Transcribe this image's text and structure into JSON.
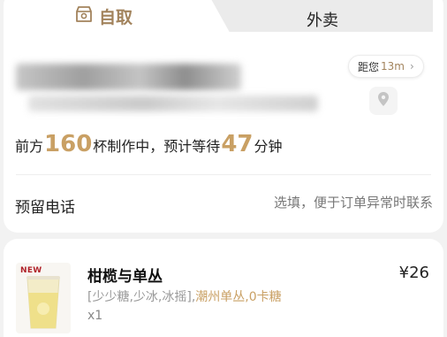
{
  "tabs": {
    "pickup_label": "自取",
    "delivery_label": "外卖",
    "active": "pickup"
  },
  "store": {
    "distance_prefix": "距您",
    "distance_value": "13m",
    "map_pin_icon": "location-pin-icon"
  },
  "queue": {
    "prefix": "前方",
    "cups": "160",
    "middle": "杯制作中，预计等待",
    "minutes": "47",
    "suffix": "分钟"
  },
  "phone": {
    "label": "预留电话",
    "placeholder": "选填，便于订单异常时联系"
  },
  "product": {
    "badge": "NEW",
    "name": "柑榄与单丛",
    "price": "¥26",
    "options_plain": "[少少糖,少冰,冰摇],",
    "options_highlight": "潮州单丛,0卡糖",
    "quantity": "x1"
  },
  "colors": {
    "accent": "#c9a064",
    "accent_dark": "#a2835c",
    "page_bg": "#f2f2f2"
  }
}
